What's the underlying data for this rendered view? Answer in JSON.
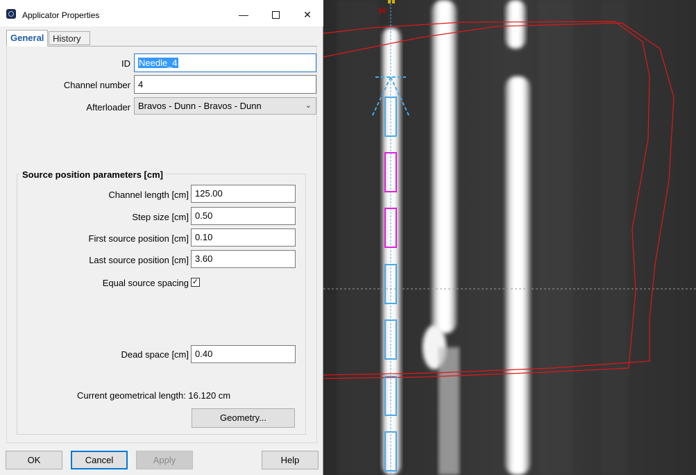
{
  "dialog": {
    "title": "Applicator Properties",
    "window_controls": {
      "minimize": "—",
      "close": "✕"
    },
    "tabs": [
      {
        "label": "General",
        "active": true
      },
      {
        "label": "History",
        "active": false
      }
    ],
    "id": {
      "label": "ID",
      "value": "Needle_4"
    },
    "channel_number": {
      "label": "Channel number",
      "value": "4"
    },
    "afterloader": {
      "label": "Afterloader",
      "value": "Bravos - Dunn - Bravos - Dunn"
    },
    "source_params": {
      "title": "Source position parameters [cm]",
      "channel_length": {
        "label": "Channel length [cm]",
        "value": "125.00"
      },
      "step_size": {
        "label": "Step size [cm]",
        "value": "0.50"
      },
      "first_source": {
        "label": "First source position [cm]",
        "value": "0.10"
      },
      "last_source": {
        "label": "Last source position [cm]",
        "value": "3.60"
      },
      "equal_spacing": {
        "label": "Equal source spacing",
        "checked": true,
        "mark": "✓"
      },
      "dead_space": {
        "label": "Dead space [cm]",
        "value": "0.40"
      },
      "current_length_text": "Current geometrical length: 16.120 cm",
      "geometry_button": "Geometry..."
    },
    "footer": {
      "ok": "OK",
      "cancel": "Cancel",
      "apply": "Apply",
      "help": "Help"
    }
  },
  "viewport": {
    "marker_label": "H",
    "colors": {
      "contour": "#e01818",
      "channel": "#4aa8e8",
      "active_dwell": "#e020e0",
      "marker": "#c00000"
    }
  }
}
